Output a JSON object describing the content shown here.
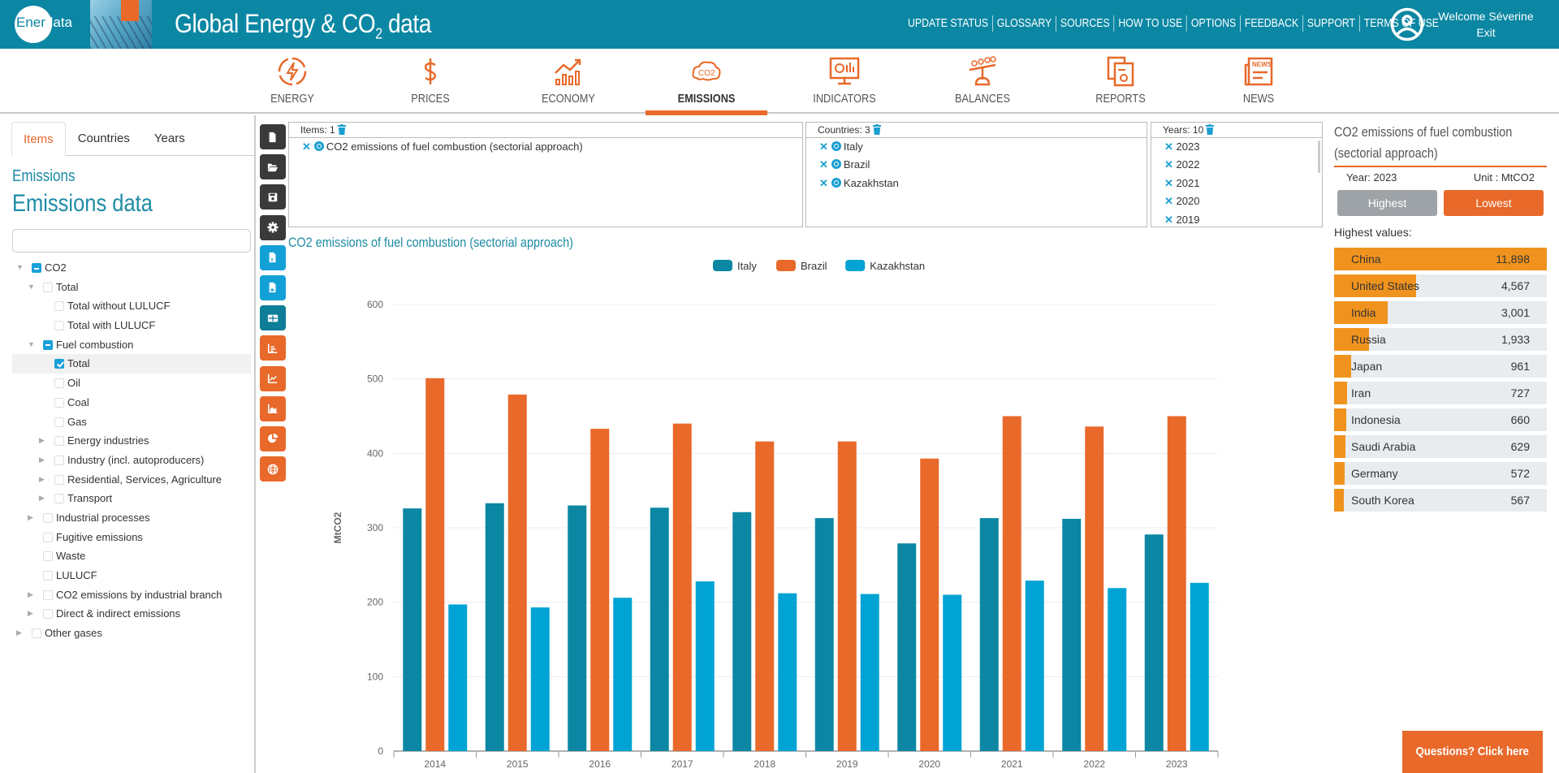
{
  "header": {
    "logo_text_a": "Ener",
    "logo_text_b": "data",
    "title_main": "Global Energy & CO",
    "title_sub": "2",
    "title_end": " data",
    "links": [
      "UPDATE STATUS",
      "GLOSSARY",
      "SOURCES",
      "HOW TO USE",
      "OPTIONS",
      "FEEDBACK",
      "SUPPORT",
      "TERMS OF USE"
    ],
    "welcome": "Welcome Séverine",
    "exit": "Exit"
  },
  "nav": {
    "items": [
      {
        "label": "ENERGY",
        "icon": "energy-icon"
      },
      {
        "label": "PRICES",
        "icon": "dollar-icon"
      },
      {
        "label": "ECONOMY",
        "icon": "economy-chart-icon"
      },
      {
        "label": "EMISSIONS",
        "icon": "co2-cloud-icon",
        "active": true
      },
      {
        "label": "INDICATORS",
        "icon": "monitor-chart-icon"
      },
      {
        "label": "BALANCES",
        "icon": "balance-scale-icon"
      },
      {
        "label": "REPORTS",
        "icon": "reports-icon"
      },
      {
        "label": "NEWS",
        "icon": "newspaper-icon"
      }
    ],
    "accent": "#e8692a"
  },
  "left_panel": {
    "tabs": [
      "Items",
      "Countries",
      "Years"
    ],
    "active_tab": "Items",
    "section_sub": "Emissions",
    "section_title": "Emissions data",
    "search_placeholder": "",
    "tree": [
      {
        "label": "CO2",
        "level": 0,
        "arrow": "down",
        "state": "partial"
      },
      {
        "label": "Total",
        "level": 1,
        "arrow": "down",
        "state": "unchecked"
      },
      {
        "label": "Total without LULUCF",
        "level": 2,
        "arrow": "",
        "state": "unchecked"
      },
      {
        "label": "Total with LULUCF",
        "level": 2,
        "arrow": "",
        "state": "unchecked"
      },
      {
        "label": "Fuel combustion",
        "level": 1,
        "arrow": "down",
        "state": "partial"
      },
      {
        "label": "Total",
        "level": 2,
        "arrow": "",
        "state": "checked",
        "highlight": true
      },
      {
        "label": "Oil",
        "level": 2,
        "arrow": "",
        "state": "unchecked"
      },
      {
        "label": "Coal",
        "level": 2,
        "arrow": "",
        "state": "unchecked"
      },
      {
        "label": "Gas",
        "level": 2,
        "arrow": "",
        "state": "unchecked"
      },
      {
        "label": "Energy industries",
        "level": 2,
        "arrow": "right",
        "state": "unchecked"
      },
      {
        "label": "Industry (incl. autoproducers)",
        "level": 2,
        "arrow": "right",
        "state": "unchecked"
      },
      {
        "label": "Residential, Services, Agriculture",
        "level": 2,
        "arrow": "right",
        "state": "unchecked"
      },
      {
        "label": "Transport",
        "level": 2,
        "arrow": "right",
        "state": "unchecked"
      },
      {
        "label": "Industrial processes",
        "level": 1,
        "arrow": "right",
        "state": "unchecked"
      },
      {
        "label": "Fugitive emissions",
        "level": 1,
        "arrow": "",
        "state": "unchecked"
      },
      {
        "label": "Waste",
        "level": 1,
        "arrow": "",
        "state": "unchecked"
      },
      {
        "label": "LULUCF",
        "level": 1,
        "arrow": "",
        "state": "unchecked"
      },
      {
        "label": "CO2 emissions by industrial branch",
        "level": 1,
        "arrow": "right",
        "state": "unchecked"
      },
      {
        "label": "Direct & indirect emissions",
        "level": 1,
        "arrow": "right",
        "state": "unchecked"
      },
      {
        "label": "Other gases",
        "level": 0,
        "arrow": "right",
        "state": "unchecked"
      }
    ]
  },
  "tools": [
    {
      "name": "new-file-button",
      "icon": "file-icon",
      "color": "dark"
    },
    {
      "name": "open-folder-button",
      "icon": "folder-open-icon",
      "color": "dark"
    },
    {
      "name": "save-button",
      "icon": "save-icon",
      "color": "dark"
    },
    {
      "name": "settings-button",
      "icon": "gear-icon",
      "color": "dark"
    },
    {
      "name": "export-excel-button",
      "icon": "excel-file-icon",
      "color": "blue"
    },
    {
      "name": "export-image-button",
      "icon": "image-file-icon",
      "color": "blue"
    },
    {
      "name": "table-view-button",
      "icon": "table-icon",
      "color": "teal"
    },
    {
      "name": "bar-chart-button",
      "icon": "bar-chart-icon",
      "color": "orange"
    },
    {
      "name": "line-chart-button",
      "icon": "line-chart-icon",
      "color": "orange"
    },
    {
      "name": "area-chart-button",
      "icon": "area-chart-icon",
      "color": "orange"
    },
    {
      "name": "pie-chart-button",
      "icon": "pie-chart-icon",
      "color": "orange"
    },
    {
      "name": "map-button",
      "icon": "globe-icon",
      "color": "orange"
    }
  ],
  "selections": {
    "items": {
      "header": "Items: 1",
      "rows": [
        "CO2 emissions of fuel combustion (sectorial approach)"
      ]
    },
    "countries": {
      "header": "Countries: 3",
      "rows": [
        "Italy",
        "Brazil",
        "Kazakhstan"
      ]
    },
    "years": {
      "header": "Years: 10",
      "rows": [
        "2023",
        "2022",
        "2021",
        "2020",
        "2019"
      ]
    }
  },
  "chart_title": "CO2 emissions of fuel combustion (sectorial approach)",
  "chart_data": {
    "type": "bar",
    "title": "CO2 emissions of fuel combustion (sectorial approach)",
    "xlabel": "",
    "ylabel": "MtCO2",
    "ylim": [
      0,
      600
    ],
    "yticks": [
      0,
      100,
      200,
      300,
      400,
      500,
      600
    ],
    "grid": true,
    "legend": "top-center",
    "categories": [
      "2014",
      "2015",
      "2016",
      "2017",
      "2018",
      "2019",
      "2020",
      "2021",
      "2022",
      "2023"
    ],
    "series": [
      {
        "name": "Italy",
        "color": "#0b87a3",
        "values": [
          326,
          333,
          330,
          327,
          321,
          313,
          279,
          313,
          312,
          291
        ]
      },
      {
        "name": "Brazil",
        "color": "#e8692a",
        "values": [
          501,
          479,
          433,
          440,
          416,
          416,
          393,
          450,
          436,
          450
        ]
      },
      {
        "name": "Kazakhstan",
        "color": "#00a3d3",
        "values": [
          197,
          193,
          206,
          228,
          212,
          211,
          210,
          229,
          219,
          226
        ]
      }
    ]
  },
  "right_panel": {
    "title": "CO2 emissions of fuel combustion (sectorial approach)",
    "year": "Year: 2023",
    "unit": "Unit : MtCO2",
    "btn_highest": "Highest",
    "btn_lowest": "Lowest",
    "list_label": "Highest values:",
    "max_value": 11898,
    "ranking": [
      {
        "country": "China",
        "value": 11898,
        "display": "11,898"
      },
      {
        "country": "United States",
        "value": 4567,
        "display": "4,567"
      },
      {
        "country": "India",
        "value": 3001,
        "display": "3,001"
      },
      {
        "country": "Russia",
        "value": 1933,
        "display": "1,933"
      },
      {
        "country": "Japan",
        "value": 961,
        "display": "961"
      },
      {
        "country": "Iran",
        "value": 727,
        "display": "727"
      },
      {
        "country": "Indonesia",
        "value": 660,
        "display": "660"
      },
      {
        "country": "Saudi Arabia",
        "value": 629,
        "display": "629"
      },
      {
        "country": "Germany",
        "value": 572,
        "display": "572"
      },
      {
        "country": "South Korea",
        "value": 567,
        "display": "567"
      }
    ]
  },
  "help_button": "Questions? Click here"
}
